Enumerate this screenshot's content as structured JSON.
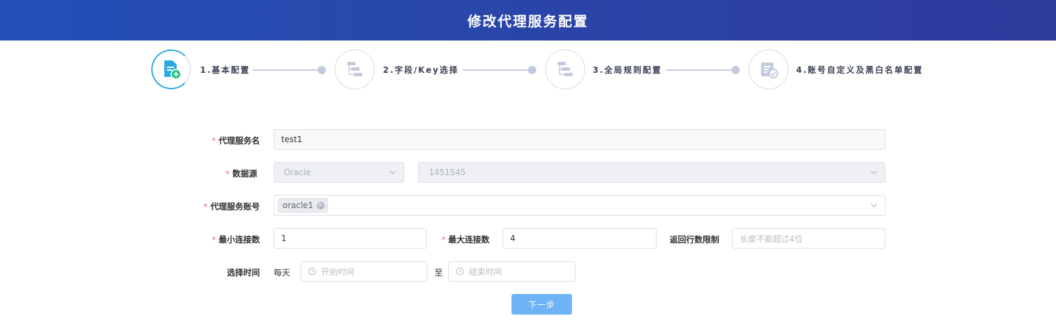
{
  "header": {
    "title": "修改代理服务配置"
  },
  "steps": [
    {
      "label": "1.基本配置",
      "icon": "document-add-icon",
      "active": true
    },
    {
      "label": "2.字段/Key选择",
      "icon": "tree-structure-icon",
      "active": false
    },
    {
      "label": "3.全局规则配置",
      "icon": "tree-structure-icon",
      "active": false
    },
    {
      "label": "4.账号自定义及黑白名单配置",
      "icon": "list-check-icon",
      "active": false
    }
  ],
  "form": {
    "proxy_name": {
      "label": "代理服务名",
      "value": "test1"
    },
    "datasource": {
      "label": "数据源",
      "type_value": "Oracle",
      "instance_value": "1451545"
    },
    "proxy_account": {
      "label": "代理服务账号",
      "tags": [
        "oracle1"
      ]
    },
    "min_conn": {
      "label": "最小连接数",
      "value": "1"
    },
    "max_conn": {
      "label": "最大连接数",
      "value": "4"
    },
    "row_limit": {
      "label": "返回行数限制",
      "placeholder": "长度不能超过4位"
    },
    "time": {
      "label": "选择时间",
      "prefix": "每天",
      "start_placeholder": "开始时间",
      "separator": "至",
      "end_placeholder": "结束时间"
    },
    "required_mark": "*"
  },
  "actions": {
    "next_label": "下一步"
  },
  "colors": {
    "header_start": "#2350b8",
    "header_end": "#2e3a9c",
    "accent": "#2aa9e0",
    "button": "#6db3f6",
    "required": "#f56c6c"
  }
}
